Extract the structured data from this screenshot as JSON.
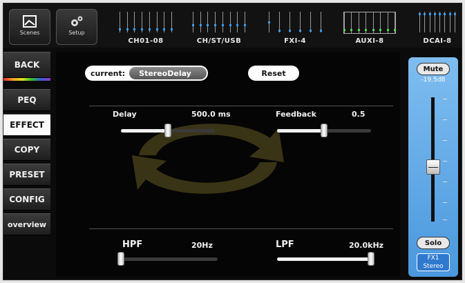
{
  "top": {
    "scenes_label": "Scenes",
    "setup_label": "Setup",
    "banks": [
      {
        "label": "CH01-08"
      },
      {
        "label": "CH/ST/USB"
      },
      {
        "label": "FXI-4"
      },
      {
        "label": "AUXI-8"
      },
      {
        "label": "DCAI-8"
      }
    ]
  },
  "nav": {
    "back": "BACK",
    "peq": "PEQ",
    "effect": "EFFECT",
    "copy": "COPY",
    "preset": "PRESET",
    "config": "CONFIG",
    "overview": "overview"
  },
  "effect": {
    "current_label": "current:",
    "current_value": "StereoDelay",
    "reset_label": "Reset",
    "delay": {
      "label": "Delay",
      "value": "500.0 ms",
      "position": 0.5
    },
    "feedback": {
      "label": "Feedback",
      "value": "0.5",
      "position": 0.5
    },
    "hpf": {
      "label": "HPF",
      "value": "20Hz",
      "position": 0.0
    },
    "lpf": {
      "label": "LPF",
      "value": "20.0kHz",
      "position": 1.0
    }
  },
  "strip": {
    "mute_label": "Mute",
    "level": "-19.5dB",
    "fader_position": 0.45,
    "solo_label": "Solo",
    "bus_name": "FX1",
    "bus_mode": "Stereo"
  },
  "colors": {
    "accent_blue": "#5aa6e6",
    "active_nav_bg": "#fafafa"
  }
}
